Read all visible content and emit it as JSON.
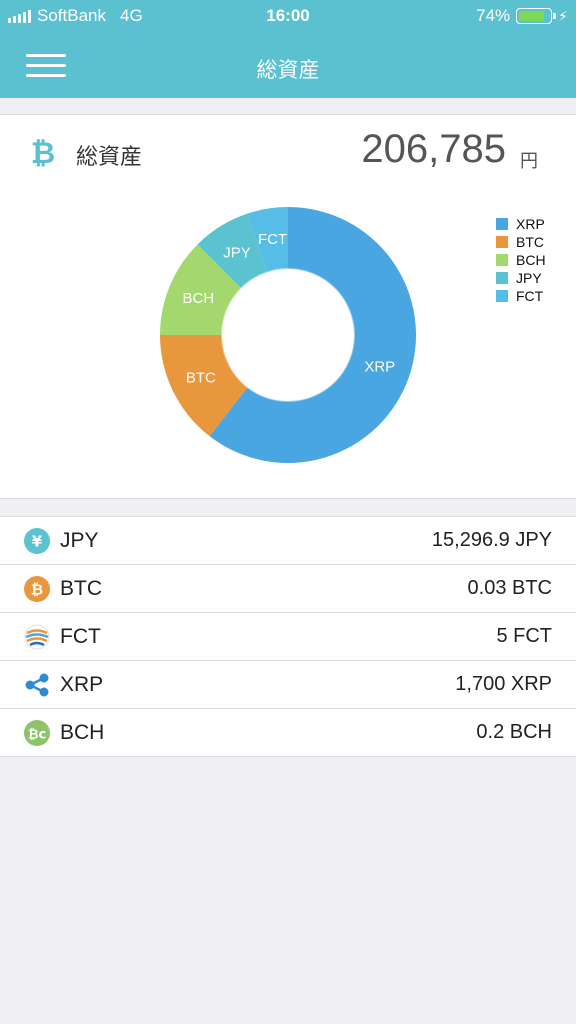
{
  "status_bar": {
    "carrier": "SoftBank",
    "network": "4G",
    "time": "16:00",
    "battery": "74%"
  },
  "nav": {
    "title": "総資産"
  },
  "total": {
    "label": "総資産",
    "value": "206,785",
    "unit": "円"
  },
  "colors": {
    "XRP": "#4aa6e0",
    "BTC": "#e9973c",
    "BCH": "#a3d86e",
    "JPY": "#5bc3d0",
    "FCT": "#55bde6"
  },
  "chart_data": {
    "type": "pie",
    "series": [
      {
        "name": "XRP",
        "value": 0.605
      },
      {
        "name": "BTC",
        "value": 0.145
      },
      {
        "name": "BCH",
        "value": 0.125
      },
      {
        "name": "JPY",
        "value": 0.074
      },
      {
        "name": "FCT",
        "value": 0.051
      }
    ],
    "legend": [
      "XRP",
      "BTC",
      "BCH",
      "JPY",
      "FCT"
    ],
    "legend_position": "top-right"
  },
  "assets": [
    {
      "name": "JPY",
      "amount": "15,296.9 JPY",
      "icon": "yen-icon"
    },
    {
      "name": "BTC",
      "amount": "0.03 BTC",
      "icon": "bitcoin-icon"
    },
    {
      "name": "FCT",
      "amount": "5 FCT",
      "icon": "factom-icon"
    },
    {
      "name": "XRP",
      "amount": "1,700 XRP",
      "icon": "ripple-icon"
    },
    {
      "name": "BCH",
      "amount": "0.2 BCH",
      "icon": "bitcoin-cash-icon"
    }
  ]
}
